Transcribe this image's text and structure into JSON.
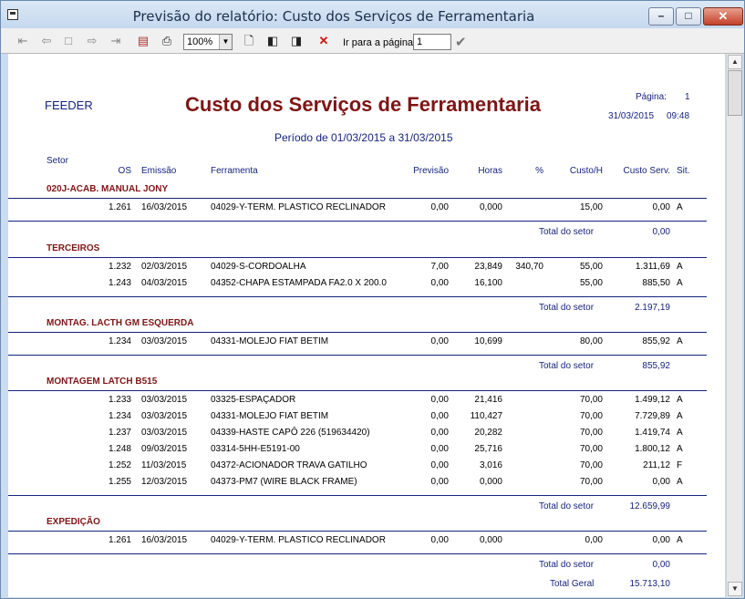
{
  "window": {
    "title": "Previsão do relatório: Custo dos Serviços de Ferramentaria"
  },
  "toolbar": {
    "zoom": "100%",
    "goto_label": "Ir para a página",
    "goto_value": "1"
  },
  "report": {
    "company": "FEEDER",
    "title": "Custo dos Serviços de Ferramentaria",
    "period": "Período de 01/03/2015 a 31/03/2015",
    "page_label": "Página:",
    "page_number": "1",
    "date": "31/03/2015",
    "time": "09:48",
    "setor_header": "Setor",
    "columns": {
      "os": "OS",
      "emissao": "Emissão",
      "ferramenta": "Ferramenta",
      "previsao": "Previsão",
      "horas": "Horas",
      "pct": "%",
      "custo_h": "Custo/H",
      "custo_serv": "Custo Serv.",
      "sit": "Sit."
    },
    "total_setor_label": "Total do setor",
    "total_geral_label": "Total Geral",
    "total_geral": "15.713,10",
    "sectors": [
      {
        "name": "020J-ACAB. MANUAL JONY",
        "total": "0,00",
        "rows": [
          {
            "os": "1.261",
            "emissao": "16/03/2015",
            "ferramenta": "04029-Y-TERM. PLASTICO RECLINADOR",
            "previsao": "0,00",
            "horas": "0,000",
            "pct": "",
            "custo_h": "15,00",
            "custo_serv": "0,00",
            "sit": "A"
          }
        ]
      },
      {
        "name": "TERCEIROS",
        "total": "2.197,19",
        "rows": [
          {
            "os": "1.232",
            "emissao": "02/03/2015",
            "ferramenta": "04029-S-CORDOALHA",
            "previsao": "7,00",
            "horas": "23,849",
            "pct": "340,70",
            "custo_h": "55,00",
            "custo_serv": "1.311,69",
            "sit": "A"
          },
          {
            "os": "1.243",
            "emissao": "04/03/2015",
            "ferramenta": "04352-CHAPA ESTAMPADA FA2.0 X 200.0",
            "previsao": "0,00",
            "horas": "16,100",
            "pct": "",
            "custo_h": "55,00",
            "custo_serv": "885,50",
            "sit": "A"
          }
        ]
      },
      {
        "name": "MONTAG. LACTH GM ESQUERDA",
        "total": "855,92",
        "rows": [
          {
            "os": "1.234",
            "emissao": "03/03/2015",
            "ferramenta": "04331-MOLEJO FIAT BETIM",
            "previsao": "0,00",
            "horas": "10,699",
            "pct": "",
            "custo_h": "80,00",
            "custo_serv": "855,92",
            "sit": "A"
          }
        ]
      },
      {
        "name": "MONTAGEM LATCH B515",
        "total": "12.659,99",
        "rows": [
          {
            "os": "1.233",
            "emissao": "03/03/2015",
            "ferramenta": "03325-ESPAÇADOR",
            "previsao": "0,00",
            "horas": "21,416",
            "pct": "",
            "custo_h": "70,00",
            "custo_serv": "1.499,12",
            "sit": "A"
          },
          {
            "os": "1.234",
            "emissao": "03/03/2015",
            "ferramenta": "04331-MOLEJO FIAT BETIM",
            "previsao": "0,00",
            "horas": "110,427",
            "pct": "",
            "custo_h": "70,00",
            "custo_serv": "7.729,89",
            "sit": "A"
          },
          {
            "os": "1.237",
            "emissao": "03/03/2015",
            "ferramenta": "04339-HASTE CAPÔ 226 (519634420)",
            "previsao": "0,00",
            "horas": "20,282",
            "pct": "",
            "custo_h": "70,00",
            "custo_serv": "1.419,74",
            "sit": "A"
          },
          {
            "os": "1.248",
            "emissao": "09/03/2015",
            "ferramenta": "03314-5HH-E5191-00",
            "previsao": "0,00",
            "horas": "25,716",
            "pct": "",
            "custo_h": "70,00",
            "custo_serv": "1.800,12",
            "sit": "A"
          },
          {
            "os": "1.252",
            "emissao": "11/03/2015",
            "ferramenta": "04372-ACIONADOR TRAVA GATILHO",
            "previsao": "0,00",
            "horas": "3,016",
            "pct": "",
            "custo_h": "70,00",
            "custo_serv": "211,12",
            "sit": "F"
          },
          {
            "os": "1.255",
            "emissao": "12/03/2015",
            "ferramenta": "04373-PM7 (WIRE BLACK FRAME)",
            "previsao": "0,00",
            "horas": "0,000",
            "pct": "",
            "custo_h": "70,00",
            "custo_serv": "0,00",
            "sit": "A"
          }
        ]
      },
      {
        "name": "EXPEDIÇÃO",
        "total": "0,00",
        "rows": [
          {
            "os": "1.261",
            "emissao": "16/03/2015",
            "ferramenta": "04029-Y-TERM. PLASTICO RECLINADOR",
            "previsao": "0,00",
            "horas": "0,000",
            "pct": "",
            "custo_h": "0,00",
            "custo_serv": "0,00",
            "sit": "A"
          }
        ]
      }
    ]
  }
}
